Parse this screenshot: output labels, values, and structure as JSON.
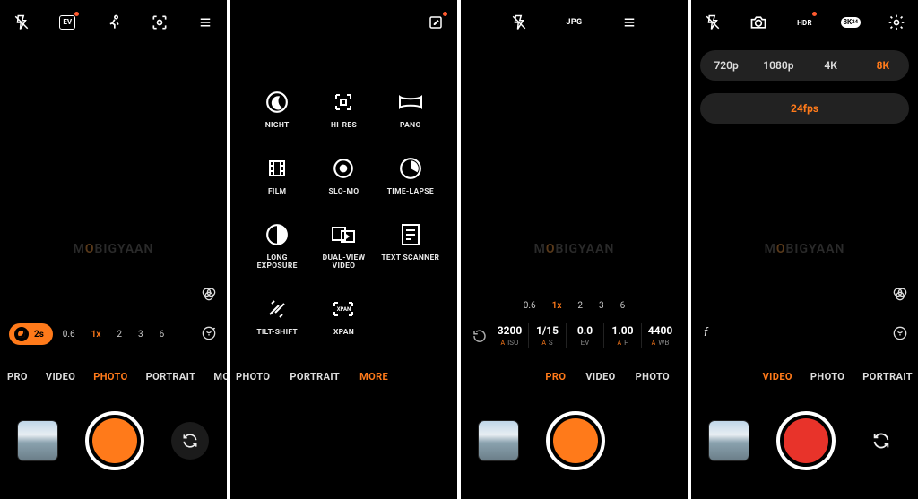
{
  "accent": "#ff7a1a",
  "watermark": "MOBIGYAAN",
  "panel1": {
    "top_icons": [
      "flash-off",
      "ev",
      "motion",
      "ai-scene",
      "menu"
    ],
    "chip_label": "2s",
    "zoom": [
      "0.6",
      "1x",
      "2",
      "3",
      "6"
    ],
    "zoom_active": 1,
    "modes": [
      "PRO",
      "VIDEO",
      "PHOTO",
      "PORTRAIT",
      "MORE"
    ],
    "mode_active": 2
  },
  "panel2": {
    "top_icons": [
      "edit"
    ],
    "grid": [
      {
        "icon": "night",
        "label": "NIGHT"
      },
      {
        "icon": "hires",
        "label": "HI-RES"
      },
      {
        "icon": "pano",
        "label": "PANO"
      },
      {
        "icon": "film",
        "label": "FILM"
      },
      {
        "icon": "slomo",
        "label": "SLO-MO"
      },
      {
        "icon": "timelapse",
        "label": "TIME-LAPSE"
      },
      {
        "icon": "longexp",
        "label": "LONG EXPOSURE"
      },
      {
        "icon": "dualview",
        "label": "DUAL-VIEW VIDEO"
      },
      {
        "icon": "textscan",
        "label": "TEXT SCANNER"
      },
      {
        "icon": "tiltshift",
        "label": "TILT-SHIFT"
      },
      {
        "icon": "xpan",
        "label": "XPAN"
      }
    ],
    "modes": [
      "PHOTO",
      "PORTRAIT",
      "MORE"
    ],
    "mode_active": 2
  },
  "panel3": {
    "top_icons": [
      "flash-off",
      "jpg",
      "menu"
    ],
    "zoom": [
      "0.6",
      "1x",
      "2",
      "3",
      "6"
    ],
    "zoom_active": 1,
    "params": [
      {
        "value": "3200",
        "label": "ISO",
        "auto": true
      },
      {
        "value": "1/15",
        "label": "S",
        "auto": true
      },
      {
        "value": "0.0",
        "label": "EV",
        "auto": false
      },
      {
        "value": "1.00",
        "label": "F",
        "auto": true
      },
      {
        "value": "4400",
        "label": "WB",
        "auto": true
      }
    ],
    "modes": [
      "PRO",
      "VIDEO",
      "PHOTO"
    ],
    "mode_active": 0
  },
  "panel4": {
    "top_icons": [
      "flash-off",
      "camera",
      "hdr",
      "8k24",
      "settings"
    ],
    "res_options": [
      "720p",
      "1080p",
      "4K",
      "8K"
    ],
    "res_active": 3,
    "fps_options": [
      "24fps"
    ],
    "fps_active": 0,
    "f_mark": "f",
    "modes": [
      "VIDEO",
      "PHOTO",
      "PORTRAIT"
    ],
    "mode_active": 0
  }
}
